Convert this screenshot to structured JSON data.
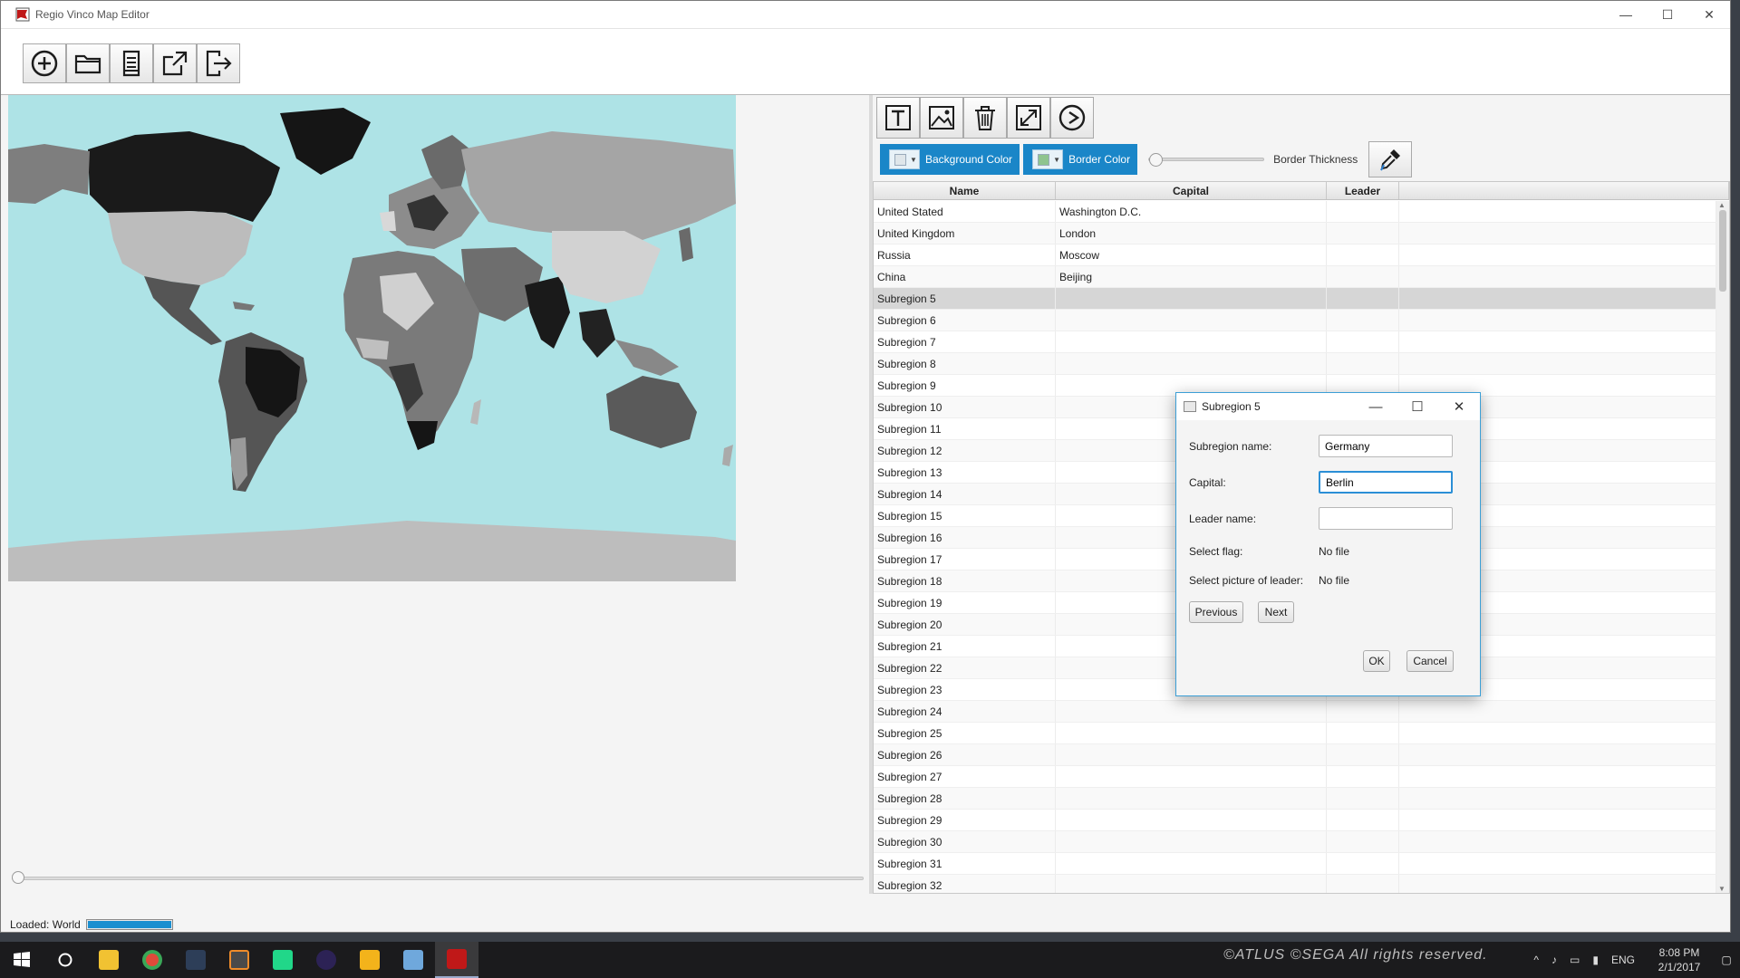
{
  "window": {
    "title": "Regio Vinco Map Editor",
    "minimize": "—",
    "maximize": "☐",
    "close": "✕"
  },
  "toolbar": {
    "buttons": [
      "new-map-icon",
      "open-folder-icon",
      "save-document-icon",
      "export-icon",
      "exit-icon"
    ]
  },
  "edit_toolbar": {
    "buttons": [
      "text-icon",
      "image-icon",
      "trash-icon",
      "resize-icon",
      "play-icon"
    ]
  },
  "style_bar": {
    "background_color_label": "Background Color",
    "background_swatch": "#dfe6ea",
    "border_color_label": "Border Color",
    "border_swatch": "#8fc48f",
    "thickness_label": "Border Thickness",
    "thickness_value": 0
  },
  "table": {
    "headers": {
      "name": "Name",
      "capital": "Capital",
      "leader": "Leader"
    },
    "rows": [
      {
        "name": "United Stated",
        "capital": "Washington D.C.",
        "leader": ""
      },
      {
        "name": "United Kingdom",
        "capital": "London",
        "leader": ""
      },
      {
        "name": "Russia",
        "capital": "Moscow",
        "leader": ""
      },
      {
        "name": "China",
        "capital": "Beijing",
        "leader": ""
      },
      {
        "name": "Subregion 5",
        "capital": "",
        "leader": "",
        "selected": true
      },
      {
        "name": "Subregion 6",
        "capital": "",
        "leader": ""
      },
      {
        "name": "Subregion 7",
        "capital": "",
        "leader": ""
      },
      {
        "name": "Subregion 8",
        "capital": "",
        "leader": ""
      },
      {
        "name": "Subregion 9",
        "capital": "",
        "leader": ""
      },
      {
        "name": "Subregion 10",
        "capital": "",
        "leader": ""
      },
      {
        "name": "Subregion 11",
        "capital": "",
        "leader": ""
      },
      {
        "name": "Subregion 12",
        "capital": "",
        "leader": ""
      },
      {
        "name": "Subregion 13",
        "capital": "",
        "leader": ""
      },
      {
        "name": "Subregion 14",
        "capital": "",
        "leader": ""
      },
      {
        "name": "Subregion 15",
        "capital": "",
        "leader": ""
      },
      {
        "name": "Subregion 16",
        "capital": "",
        "leader": ""
      },
      {
        "name": "Subregion 17",
        "capital": "",
        "leader": ""
      },
      {
        "name": "Subregion 18",
        "capital": "",
        "leader": ""
      },
      {
        "name": "Subregion 19",
        "capital": "",
        "leader": ""
      },
      {
        "name": "Subregion 20",
        "capital": "",
        "leader": ""
      },
      {
        "name": "Subregion 21",
        "capital": "",
        "leader": ""
      },
      {
        "name": "Subregion 22",
        "capital": "",
        "leader": ""
      },
      {
        "name": "Subregion 23",
        "capital": "",
        "leader": ""
      },
      {
        "name": "Subregion 24",
        "capital": "",
        "leader": ""
      },
      {
        "name": "Subregion 25",
        "capital": "",
        "leader": ""
      },
      {
        "name": "Subregion 26",
        "capital": "",
        "leader": ""
      },
      {
        "name": "Subregion 27",
        "capital": "",
        "leader": ""
      },
      {
        "name": "Subregion 28",
        "capital": "",
        "leader": ""
      },
      {
        "name": "Subregion 29",
        "capital": "",
        "leader": ""
      },
      {
        "name": "Subregion 30",
        "capital": "",
        "leader": ""
      },
      {
        "name": "Subregion 31",
        "capital": "",
        "leader": ""
      },
      {
        "name": "Subregion 32",
        "capital": "",
        "leader": ""
      }
    ]
  },
  "status": {
    "text": "Loaded: World",
    "progress": 1.0,
    "progress_color": "#1a8fd0"
  },
  "dialog": {
    "title": "Subregion 5",
    "fields": {
      "name_label": "Subregion name:",
      "name_value": "Germany",
      "capital_label": "Capital:",
      "capital_value": "Berlin",
      "leader_label": "Leader name:",
      "leader_value": "",
      "flag_label": "Select flag:",
      "flag_value": "No file",
      "leader_pic_label": "Select picture of leader:",
      "leader_pic_value": "No file"
    },
    "previous_label": "Previous",
    "next_label": "Next",
    "ok_label": "OK",
    "cancel_label": "Cancel"
  },
  "taskbar": {
    "watermark": "©ATLUS ©SEGA All rights reserved.",
    "language": "ENG",
    "time": "8:08 PM",
    "date": "2/1/2017"
  },
  "colors": {
    "ocean": "#aee3e6",
    "accent": "#1a86c8"
  }
}
